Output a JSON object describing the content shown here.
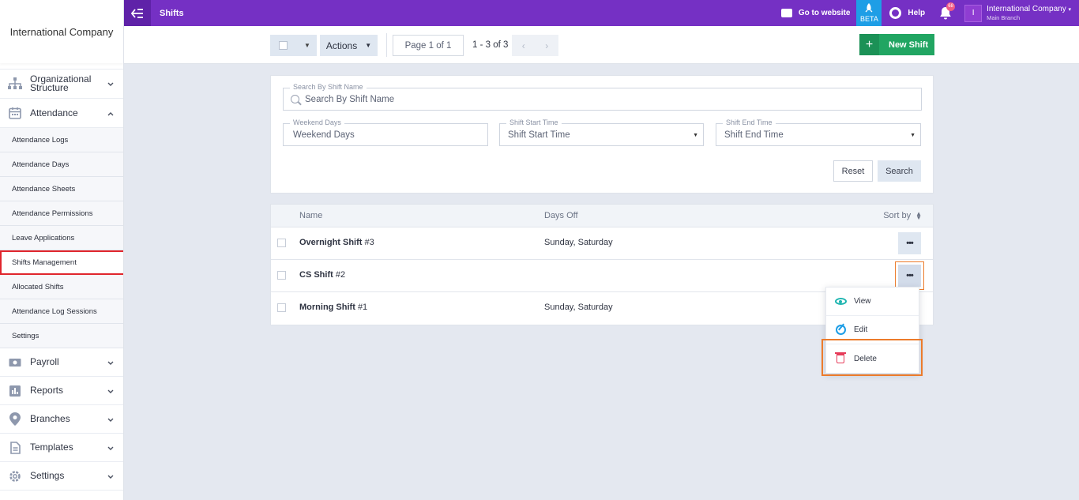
{
  "sidebar": {
    "company": "International Company",
    "items": [
      {
        "label": "Organizational Structure",
        "icon": "org-chart-icon"
      },
      {
        "label": "Attendance",
        "icon": "calendar-icon",
        "expanded": true
      }
    ],
    "attendance_sub": [
      "Attendance Logs",
      "Attendance Days",
      "Attendance Sheets",
      "Attendance Permissions",
      "Leave Applications",
      "Shifts Management",
      "Allocated Shifts",
      "Attendance Log Sessions",
      "Settings"
    ],
    "active_sub": "Shifts Management",
    "bottom_items": [
      {
        "label": "Payroll",
        "icon": "money-icon"
      },
      {
        "label": "Reports",
        "icon": "bar-chart-icon"
      },
      {
        "label": "Branches",
        "icon": "map-pin-icon"
      },
      {
        "label": "Templates",
        "icon": "document-icon"
      },
      {
        "label": "Settings",
        "icon": "gear-icon"
      }
    ]
  },
  "topbar": {
    "title": "Shifts",
    "go_website": "Go to website",
    "beta": "BETA",
    "help": "Help",
    "notifications": "68",
    "avatar_letter": "I",
    "account_name": "International Company",
    "account_branch": "Main Branch",
    "color": "#7530c4"
  },
  "toolbar": {
    "actions": "Actions",
    "page": "Page 1 of 1",
    "range": "1 - 3 of 3",
    "new_shift": "New Shift"
  },
  "filters": {
    "search_label": "Search By Shift Name",
    "search_placeholder": "Search By Shift Name",
    "weekend_label": "Weekend Days",
    "weekend_placeholder": "Weekend Days",
    "start_label": "Shift Start Time",
    "start_value": "Shift Start Time",
    "end_label": "Shift End Time",
    "end_value": "Shift End Time",
    "reset": "Reset",
    "search": "Search"
  },
  "table": {
    "col_name": "Name",
    "col_days": "Days Off",
    "sort_by": "Sort by",
    "rows": [
      {
        "name": "Overnight Shift",
        "id": "#3",
        "days_off": "Sunday, Saturday"
      },
      {
        "name": "CS Shift",
        "id": "#2",
        "days_off": ""
      },
      {
        "name": "Morning Shift",
        "id": "#1",
        "days_off": "Sunday, Saturday"
      }
    ]
  },
  "context_menu": {
    "view": "View",
    "edit": "Edit",
    "delete": "Delete"
  }
}
